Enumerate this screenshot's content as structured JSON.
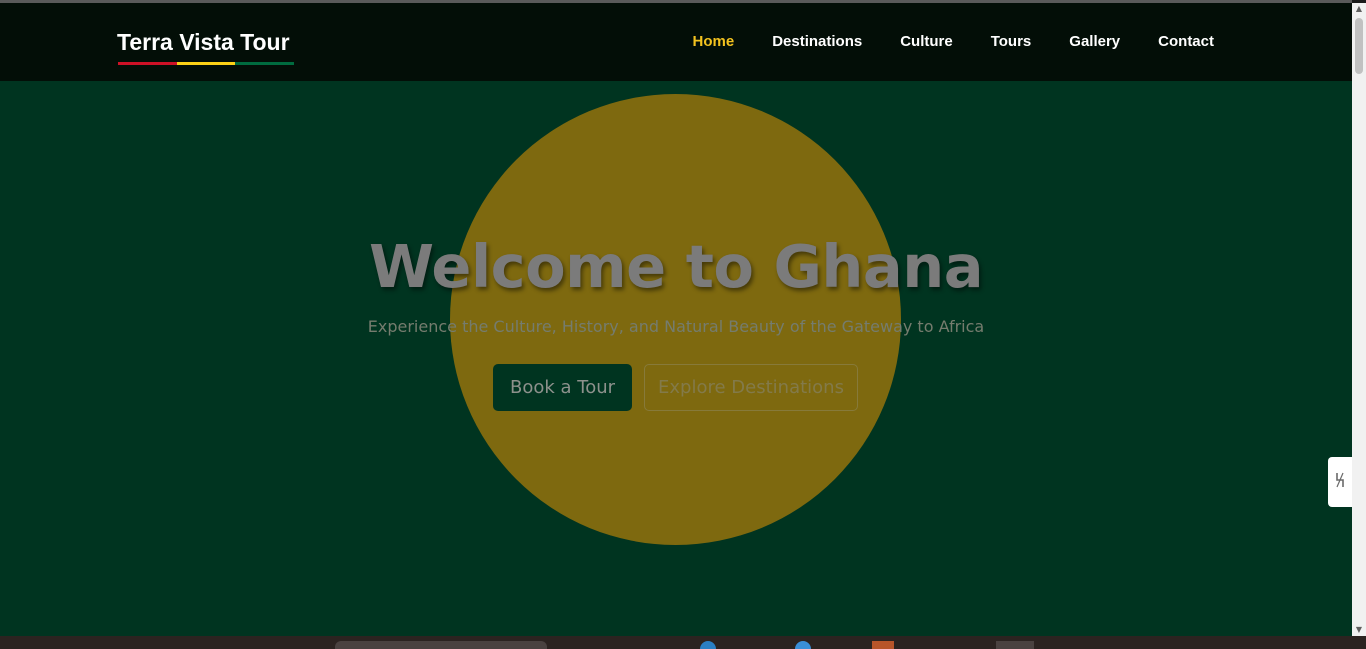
{
  "brand": {
    "name": "Terra Vista Tour",
    "underline_colors": [
      "#ce1126",
      "#fcd116",
      "#006b3f"
    ]
  },
  "nav": {
    "items": [
      {
        "label": "Home",
        "active": true
      },
      {
        "label": "Destinations",
        "active": false
      },
      {
        "label": "Culture",
        "active": false
      },
      {
        "label": "Tours",
        "active": false
      },
      {
        "label": "Gallery",
        "active": false
      },
      {
        "label": "Contact",
        "active": false
      }
    ],
    "active_color": "#f3c21f"
  },
  "hero": {
    "title": "Welcome to Ghana",
    "subtitle": "Experience the Culture, History, and Natural Beauty of the Gateway to Africa",
    "primary_button": "Book a Tour",
    "secondary_button": "Explore Destinations",
    "background_color": "#003420",
    "sun_color": "#7e690f"
  },
  "side_widget": {
    "icon": "accessibility-icon"
  }
}
